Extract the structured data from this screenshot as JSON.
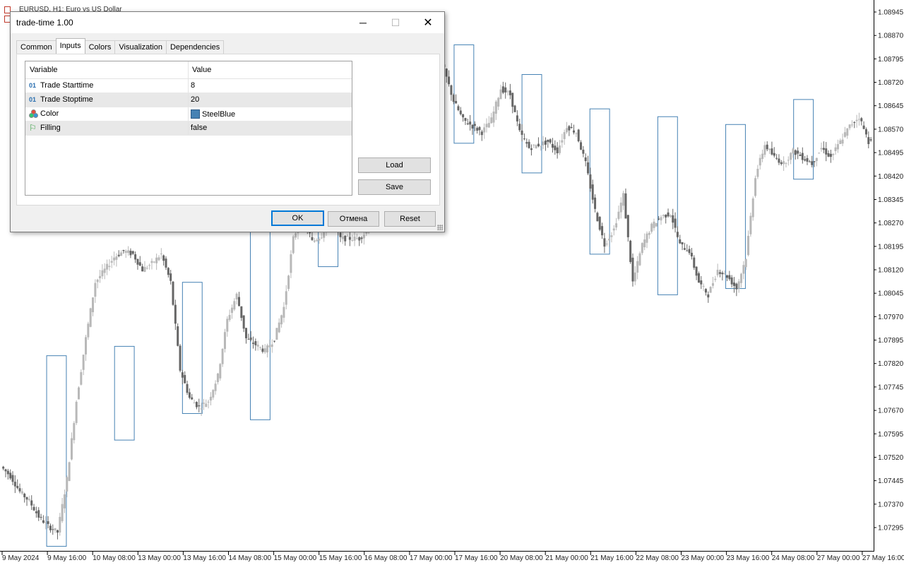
{
  "chart": {
    "title": "EURUSD, H1:  Euro vs US Dollar",
    "box_color": "#4682B4",
    "up_color": "#b8b8b8",
    "down_color": "#666666",
    "price_labels": [
      "1.08945",
      "1.08870",
      "1.08795",
      "1.08720",
      "1.08645",
      "1.08570",
      "1.08495",
      "1.08420",
      "1.08345",
      "1.08270",
      "1.08195",
      "1.08120",
      "1.08045",
      "1.07970",
      "1.07895",
      "1.07820",
      "1.07745",
      "1.07670",
      "1.07595",
      "1.07520",
      "1.07445",
      "1.07370",
      "1.07295"
    ],
    "time_labels": [
      "9 May 2024",
      "9 May 16:00",
      "10 May 08:00",
      "13 May 00:00",
      "13 May 16:00",
      "14 May 08:00",
      "15 May 00:00",
      "15 May 16:00",
      "16 May 08:00",
      "17 May 00:00",
      "17 May 16:00",
      "20 May 08:00",
      "21 May 00:00",
      "21 May 16:00",
      "22 May 08:00",
      "23 May 00:00",
      "23 May 16:00",
      "24 May 08:00",
      "27 May 00:00",
      "27 May 16:00"
    ]
  },
  "chart_data": {
    "type": "candlestick",
    "symbol": "EURUSD",
    "timeframe": "H1",
    "y_axis_ticks": [
      1.08945,
      1.0887,
      1.08795,
      1.0872,
      1.08645,
      1.0857,
      1.08495,
      1.0842,
      1.08345,
      1.0827,
      1.08195,
      1.0812,
      1.08045,
      1.0797,
      1.07895,
      1.0782,
      1.07745,
      1.0767,
      1.07595,
      1.0752,
      1.07445,
      1.0737,
      1.07295
    ],
    "ylim": [
      1.0724,
      1.0898
    ],
    "x_ticks": [
      "9 May 2024",
      "9 May 16:00",
      "10 May 08:00",
      "13 May 00:00",
      "13 May 16:00",
      "14 May 08:00",
      "15 May 00:00",
      "15 May 16:00",
      "16 May 08:00",
      "17 May 00:00",
      "17 May 16:00",
      "20 May 08:00",
      "21 May 00:00",
      "21 May 16:00",
      "22 May 08:00",
      "23 May 00:00",
      "23 May 16:00",
      "24 May 08:00",
      "27 May 00:00",
      "27 May 16:00"
    ],
    "close_path": [
      [
        0,
        1.0749
      ],
      [
        1,
        1.0746
      ],
      [
        2,
        1.0741
      ],
      [
        3,
        1.0738
      ],
      [
        4,
        1.0733
      ],
      [
        5,
        1.073
      ],
      [
        6,
        1.0728
      ],
      [
        7,
        1.0745
      ],
      [
        8,
        1.077
      ],
      [
        9,
        1.079
      ],
      [
        10,
        1.0808
      ],
      [
        11,
        1.0812
      ],
      [
        12,
        1.0816
      ],
      [
        13,
        1.0818
      ],
      [
        14,
        1.0817
      ],
      [
        15,
        1.0812
      ],
      [
        16,
        1.0814
      ],
      [
        17,
        1.0817
      ],
      [
        18,
        1.0808
      ],
      [
        19,
        1.078
      ],
      [
        20,
        1.0771
      ],
      [
        21,
        1.0768
      ],
      [
        22,
        1.077
      ],
      [
        23,
        1.0778
      ],
      [
        24,
        1.0796
      ],
      [
        25,
        1.0804
      ],
      [
        26,
        1.079
      ],
      [
        27,
        1.0788
      ],
      [
        28,
        1.0786
      ],
      [
        29,
        1.079
      ],
      [
        30,
        1.08
      ],
      [
        31,
        1.0822
      ],
      [
        32,
        1.083
      ],
      [
        33,
        1.0821
      ],
      [
        34,
        1.0823
      ],
      [
        35,
        1.0829
      ],
      [
        36,
        1.0822
      ],
      [
        37,
        1.0822
      ],
      [
        38,
        1.0822
      ],
      [
        39,
        1.0825
      ],
      [
        40,
        1.0842
      ],
      [
        41,
        1.0847
      ],
      [
        42,
        1.0862
      ],
      [
        43,
        1.0871
      ],
      [
        44,
        1.0877
      ],
      [
        45,
        1.088
      ],
      [
        46,
        1.0883
      ],
      [
        47,
        1.0876
      ],
      [
        48,
        1.0866
      ],
      [
        49,
        1.086
      ],
      [
        50,
        1.0858
      ],
      [
        51,
        1.0856
      ],
      [
        52,
        1.086
      ],
      [
        53,
        1.087
      ],
      [
        54,
        1.0868
      ],
      [
        55,
        1.0856
      ],
      [
        56,
        1.0851
      ],
      [
        57,
        1.0852
      ],
      [
        58,
        1.0853
      ],
      [
        59,
        1.085
      ],
      [
        60,
        1.0858
      ],
      [
        61,
        1.0856
      ],
      [
        62,
        1.0846
      ],
      [
        63,
        1.0831
      ],
      [
        64,
        1.082
      ],
      [
        65,
        1.0825
      ],
      [
        66,
        1.0836
      ],
      [
        67,
        1.0808
      ],
      [
        68,
        1.082
      ],
      [
        69,
        1.0826
      ],
      [
        70,
        1.0829
      ],
      [
        71,
        1.083
      ],
      [
        72,
        1.082
      ],
      [
        73,
        1.0818
      ],
      [
        74,
        1.0808
      ],
      [
        75,
        1.0804
      ],
      [
        76,
        1.0812
      ],
      [
        77,
        1.081
      ],
      [
        78,
        1.0806
      ],
      [
        79,
        1.0816
      ],
      [
        80,
        1.0842
      ],
      [
        81,
        1.0852
      ],
      [
        82,
        1.0848
      ],
      [
        83,
        1.0846
      ],
      [
        84,
        1.085
      ],
      [
        85,
        1.0848
      ],
      [
        86,
        1.0846
      ],
      [
        87,
        1.0851
      ],
      [
        88,
        1.0848
      ],
      [
        89,
        1.0853
      ],
      [
        90,
        1.0858
      ],
      [
        91,
        1.0861
      ],
      [
        92,
        1.0853
      ],
      [
        93,
        1.0858
      ]
    ],
    "session_boxes": [
      {
        "start": "09 May 08:00",
        "end": "09 May 20:00",
        "high": 1.07845,
        "low": 1.07235
      },
      {
        "start": "10 May 08:00",
        "end": "10 May 20:00",
        "high": 1.07875,
        "low": 1.07575
      },
      {
        "start": "13 May 08:00",
        "end": "13 May 20:00",
        "high": 1.0808,
        "low": 1.0766
      },
      {
        "start": "14 May 08:00",
        "end": "14 May 20:00",
        "high": 1.0826,
        "low": 1.0764
      },
      {
        "start": "15 May 08:00",
        "end": "15 May 20:00",
        "high": 1.0828,
        "low": 1.0813
      },
      {
        "start": "16 May 08:00",
        "end": "16 May 20:00",
        "high": 1.0878,
        "low": 1.08355
      },
      {
        "start": "17 May 08:00",
        "end": "17 May 20:00",
        "high": 1.0884,
        "low": 1.08525
      },
      {
        "start": "20 May 08:00",
        "end": "20 May 20:00",
        "high": 1.08745,
        "low": 1.0843
      },
      {
        "start": "21 May 08:00",
        "end": "21 May 20:00",
        "high": 1.08635,
        "low": 1.0817
      },
      {
        "start": "22 May 08:00",
        "end": "22 May 20:00",
        "high": 1.0861,
        "low": 1.0804
      },
      {
        "start": "23 May 08:00",
        "end": "23 May 20:00",
        "high": 1.08585,
        "low": 1.0806
      },
      {
        "start": "24 May 08:00",
        "end": "24 May 20:00",
        "high": 1.08665,
        "low": 1.0841
      }
    ]
  },
  "dialog": {
    "title": "trade-time 1.00",
    "tabs": [
      "Common",
      "Inputs",
      "Colors",
      "Visualization",
      "Dependencies"
    ],
    "active_tab": "Inputs",
    "grid": {
      "headers": [
        "Variable",
        "Value"
      ],
      "rows": [
        {
          "icon": "01",
          "variable": "Trade Starttime",
          "value": "8"
        },
        {
          "icon": "01",
          "variable": "Trade Stoptime",
          "value": "20"
        },
        {
          "icon": "color",
          "variable": "Color",
          "value": "SteelBlue",
          "swatch": "#4682B4"
        },
        {
          "icon": "flag",
          "variable": "Filling",
          "value": "false"
        }
      ]
    },
    "buttons": {
      "load": "Load",
      "save": "Save",
      "ok": "OK",
      "cancel": "Отмена",
      "reset": "Reset"
    },
    "window_controls": {
      "minimize": "─",
      "maximize": "☐",
      "close": "✕"
    }
  }
}
